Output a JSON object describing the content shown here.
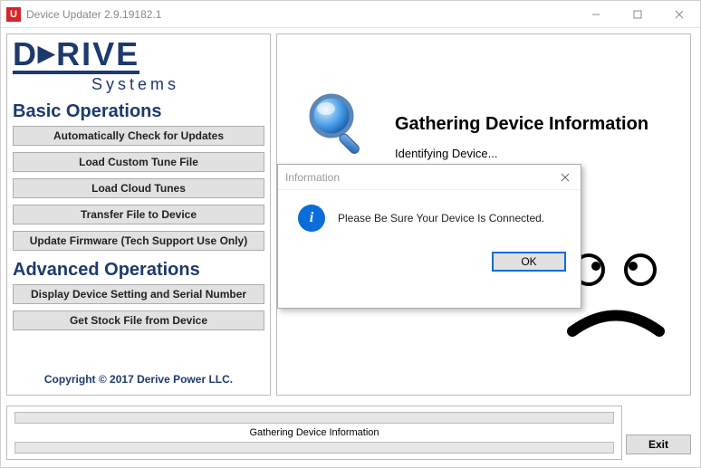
{
  "window": {
    "icon_letter": "U",
    "title": "Device Updater 2.9.19182.1"
  },
  "left": {
    "logo_main": "DERIVE",
    "logo_sub": "Systems",
    "section_basic": "Basic Operations",
    "basic_buttons": [
      "Automatically Check for Updates",
      "Load Custom Tune File",
      "Load Cloud Tunes",
      "Transfer File to Device",
      "Update Firmware (Tech Support Use Only)"
    ],
    "section_advanced": "Advanced Operations",
    "advanced_buttons": [
      "Display Device Setting and Serial Number",
      "Get Stock File from Device"
    ],
    "copyright": "Copyright © 2017 Derive Power LLC."
  },
  "right": {
    "heading": "Gathering Device Information",
    "subtext": "Identifying Device..."
  },
  "dialog": {
    "title": "Information",
    "message": "Please Be Sure Your Device Is Connected.",
    "ok": "OK"
  },
  "progress": {
    "label": "Gathering Device Information"
  },
  "exit": "Exit"
}
